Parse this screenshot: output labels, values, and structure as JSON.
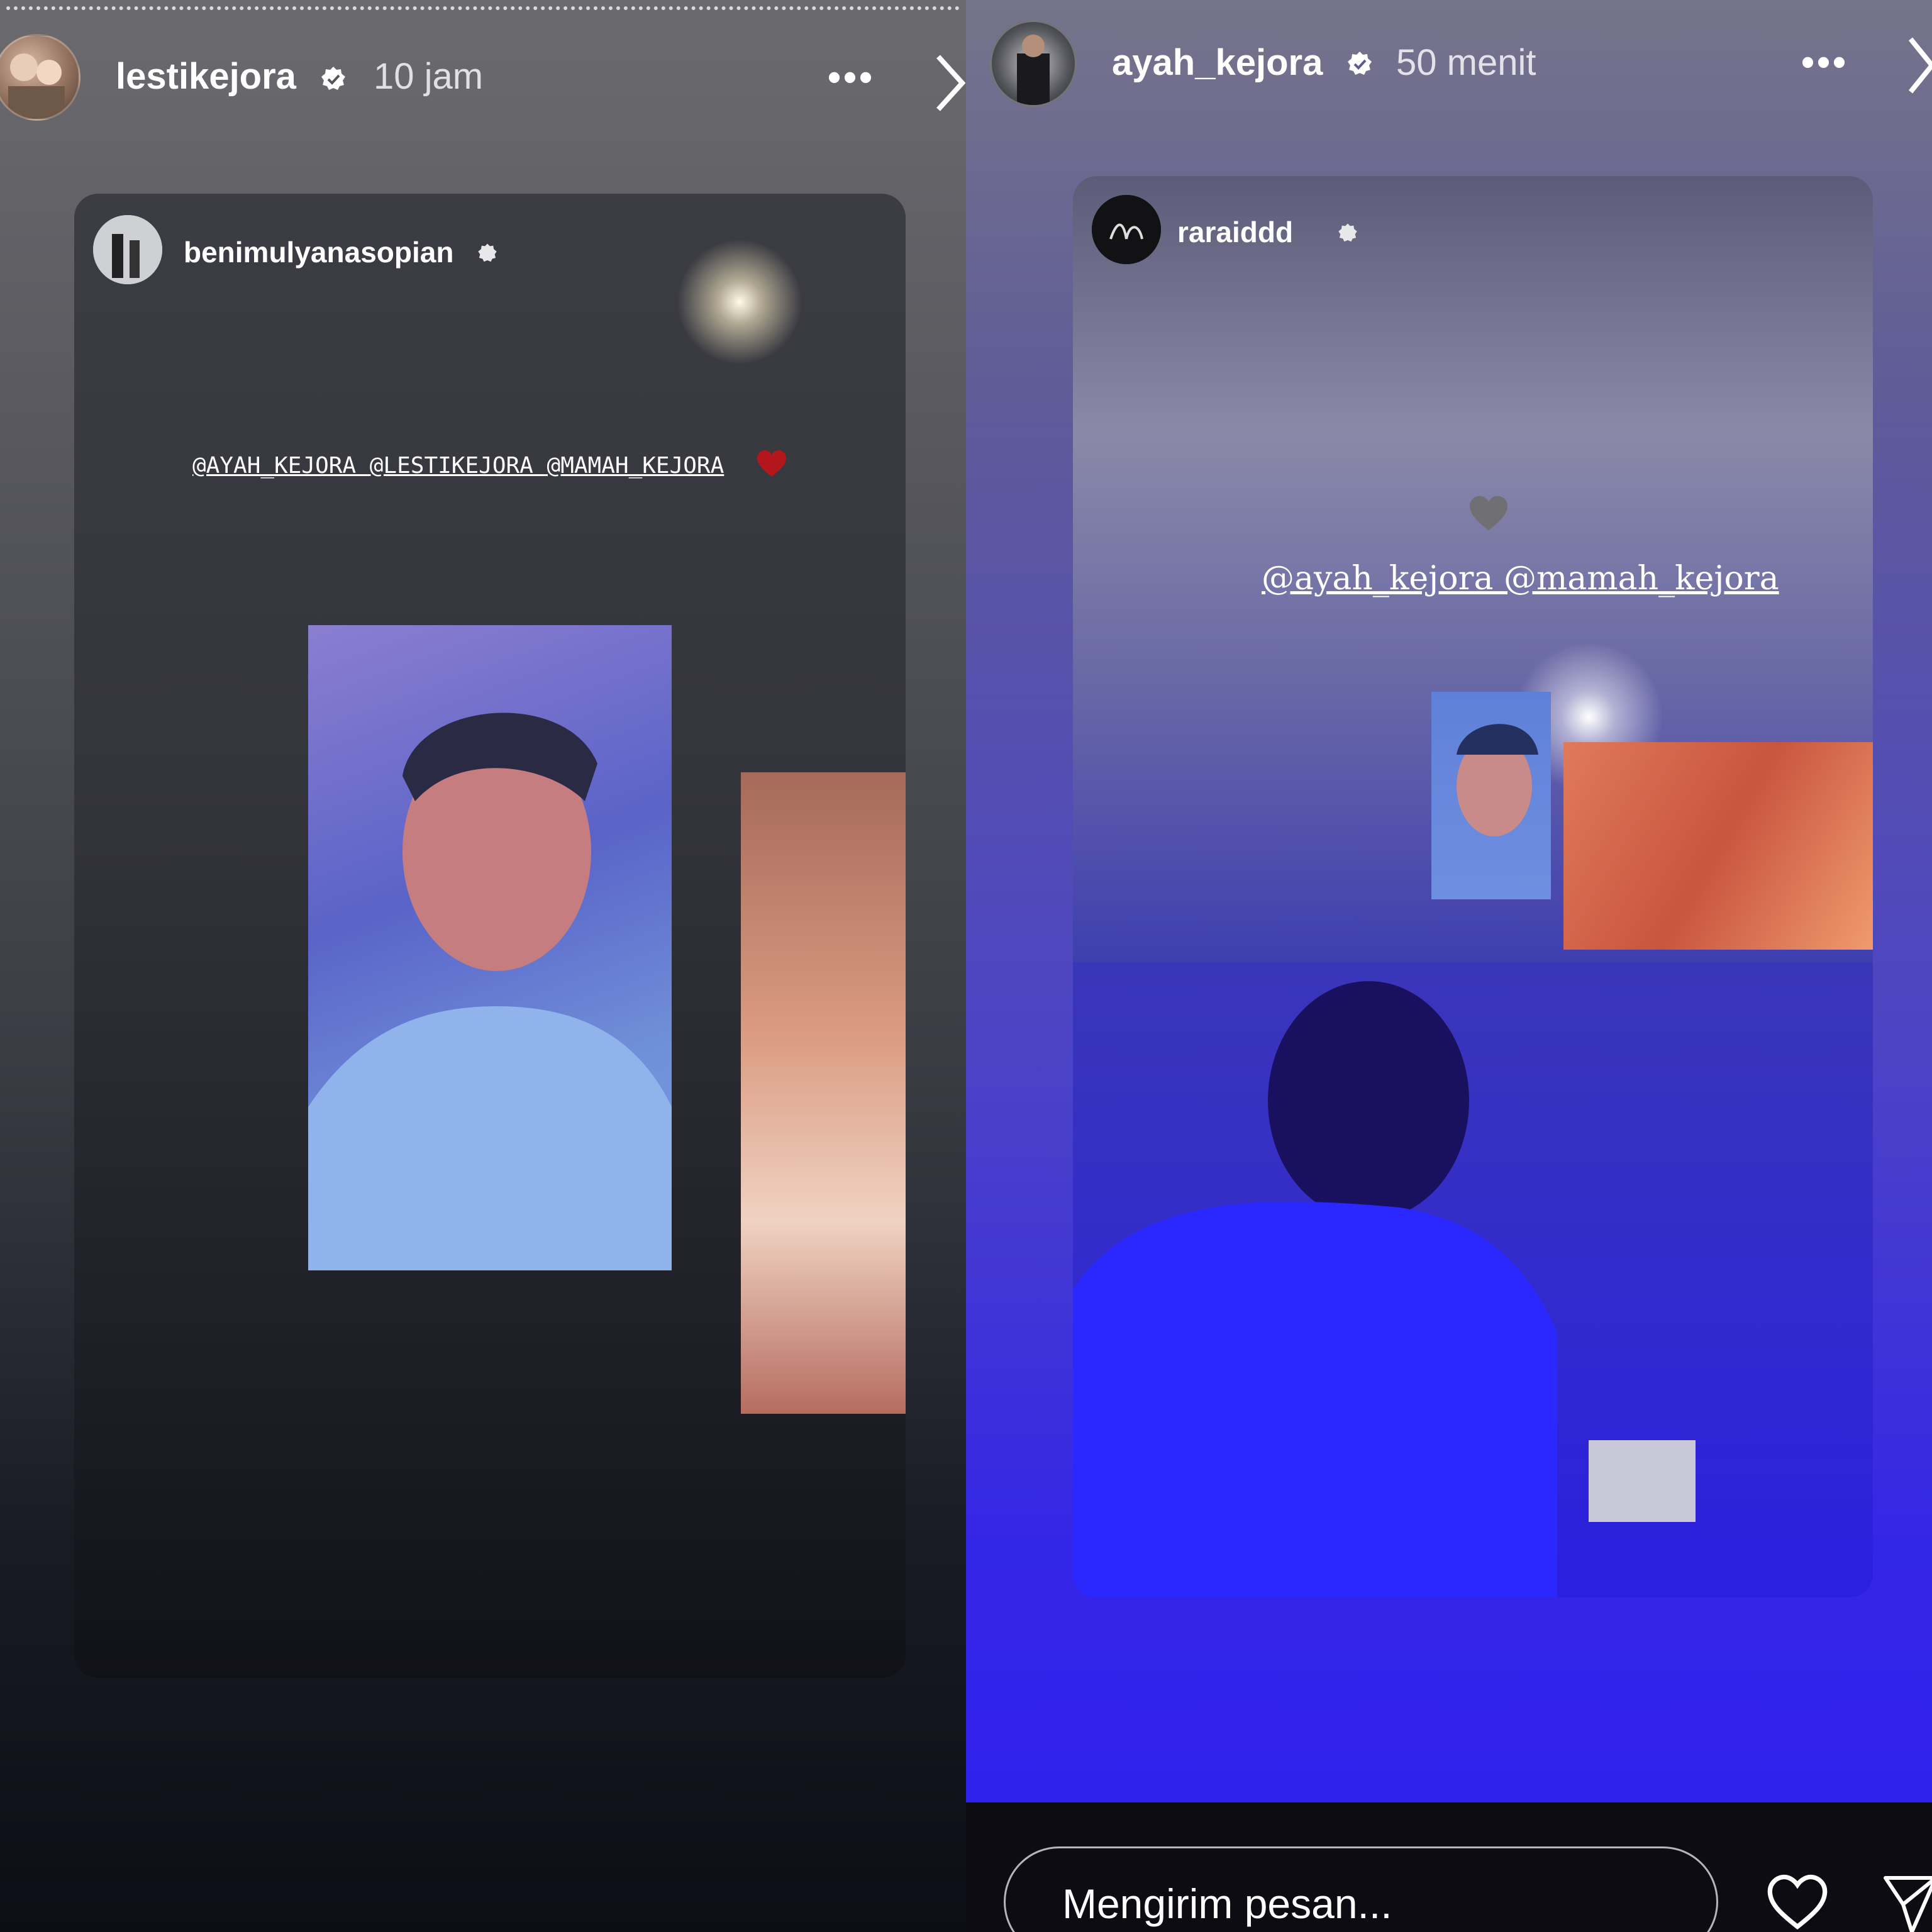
{
  "left_story": {
    "username": "lestikejora",
    "time": "10 jam",
    "more_label": "•••",
    "reshared": {
      "username": "benimulyanasopian",
      "mentions": "@AYAH_KEJORA @LESTIKEJORA @MAMAH_KEJORA"
    }
  },
  "right_story": {
    "username": "ayah_kejora",
    "time": "50 menit",
    "more_label": "•••",
    "reshared": {
      "username": "raraiddd",
      "mentions": "@ayah_kejora @mamah_kejora"
    }
  },
  "message_bar": {
    "placeholder": "Mengirim pesan..."
  },
  "colors": {
    "verified": "#ffffff",
    "heart_red": "#b3161b",
    "heart_gray": "#6f6f74"
  }
}
